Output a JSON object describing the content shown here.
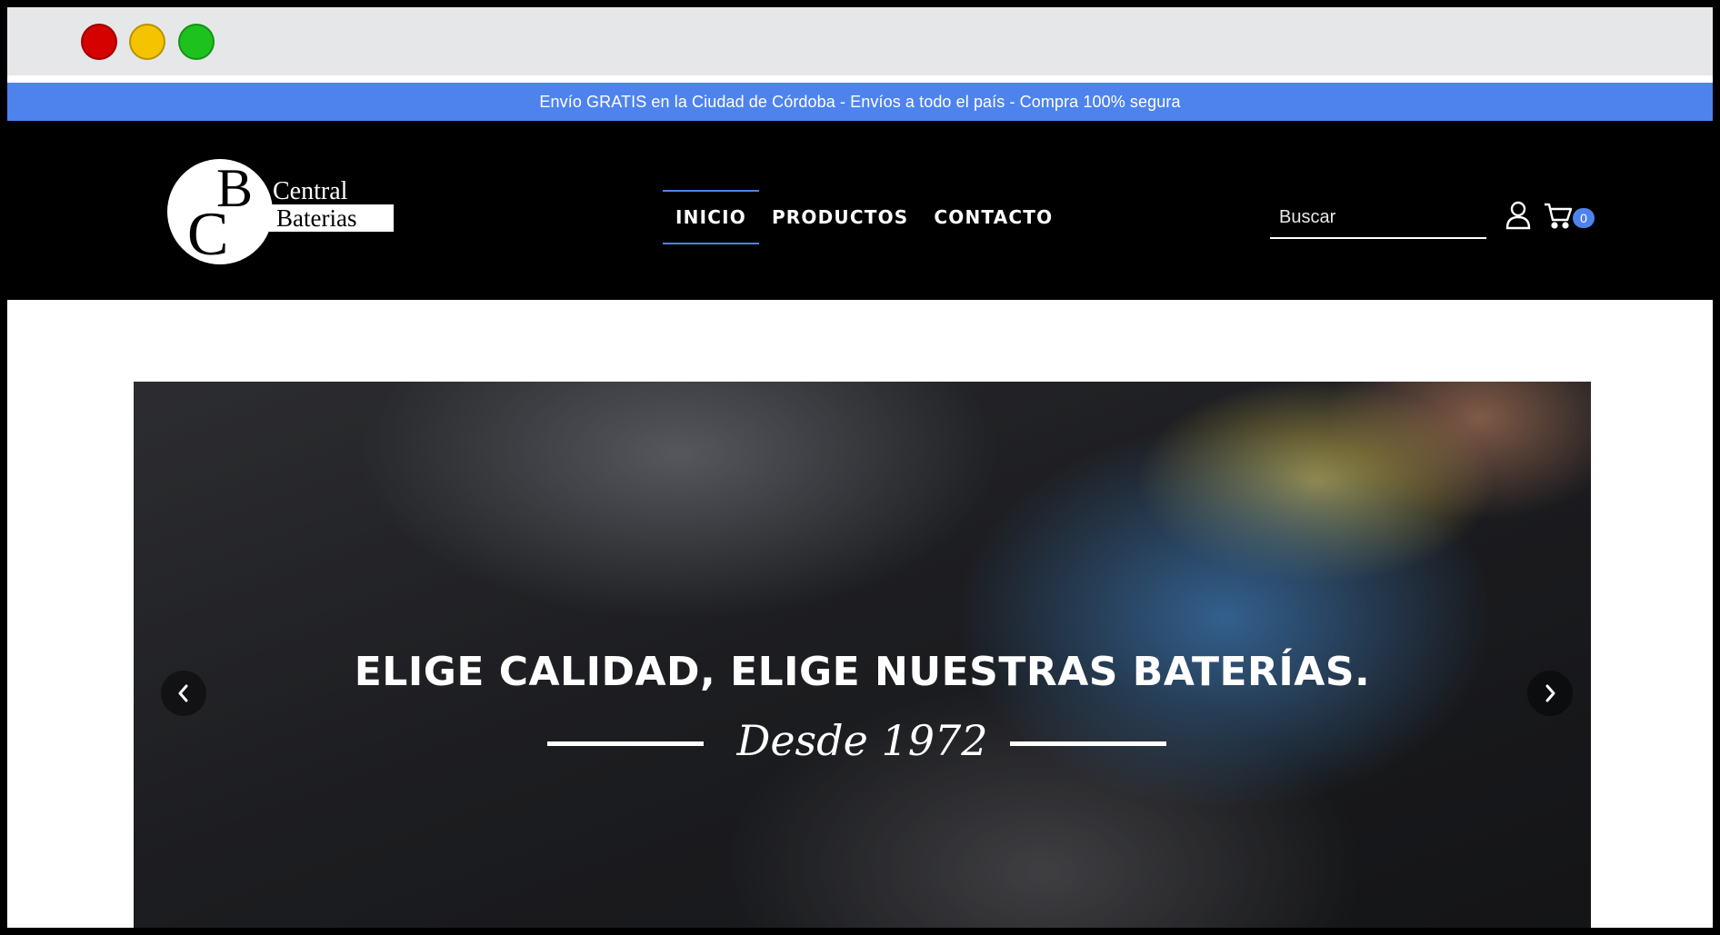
{
  "browser": {
    "traffic_lights": [
      "close",
      "minimize",
      "maximize"
    ]
  },
  "announcement": {
    "text": "Envío GRATIS en la Ciudad de Córdoba - Envíos a todo el país - Compra 100% segura"
  },
  "header": {
    "logo": {
      "monogram_c": "C",
      "monogram_b": "B",
      "line1": "Central",
      "line2": "Baterias"
    },
    "nav": [
      {
        "label": "INICIO",
        "active": true
      },
      {
        "label": "PRODUCTOS",
        "active": false
      },
      {
        "label": "CONTACTO",
        "active": false
      }
    ],
    "search": {
      "placeholder": "Buscar",
      "value": ""
    },
    "cart": {
      "count": "0"
    },
    "icons": {
      "user": "user-icon",
      "cart": "cart-icon"
    }
  },
  "hero": {
    "title": "ELIGE CALIDAD, ELIGE NUESTRAS BATERÍAS.",
    "subtitle": "Desde 1972",
    "prev_icon": "chevron-left-icon",
    "next_icon": "chevron-right-icon"
  },
  "colors": {
    "accent": "#4e83ee",
    "header_bg": "#000000",
    "titlebar_bg": "#e6e7e9"
  }
}
